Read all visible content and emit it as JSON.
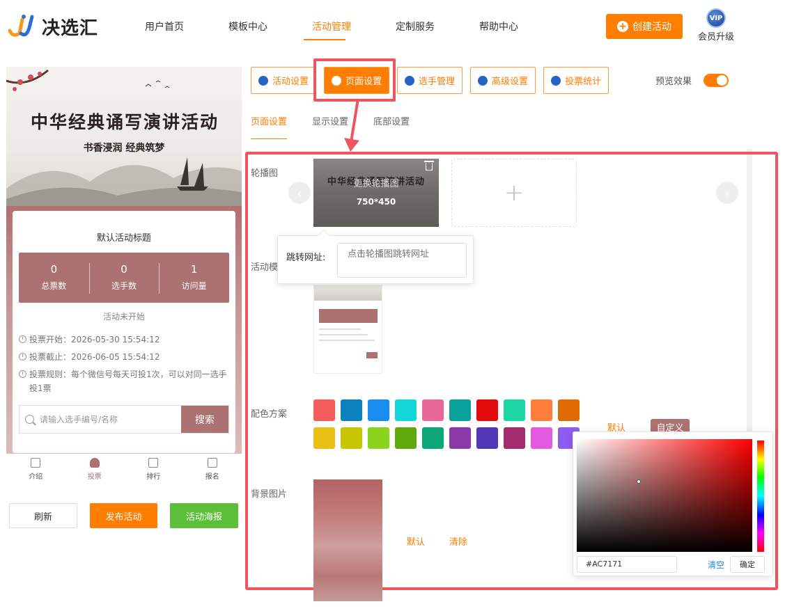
{
  "brand": {
    "name": "决选汇"
  },
  "nav": [
    "用户首页",
    "模板中心",
    "活动管理",
    "定制服务",
    "帮助中心"
  ],
  "header": {
    "create_label": "创建活动",
    "vip_badge": "VIP",
    "vip_label": "会员升级"
  },
  "toolbar": {
    "tabs": [
      "活动设置",
      "页面设置",
      "选手管理",
      "高级设置",
      "投票统计"
    ],
    "active": "页面设置",
    "preview_label": "预览效果",
    "preview_on": true
  },
  "subtabs": [
    "页面设置",
    "显示设置",
    "底部设置"
  ],
  "phone": {
    "banner_title": "中华经典诵写演讲活动",
    "banner_sub": "书香浸润   经典筑梦",
    "card_title": "默认活动标题",
    "stats": [
      {
        "num": "0",
        "label": "总票数"
      },
      {
        "num": "0",
        "label": "选手数"
      },
      {
        "num": "1",
        "label": "访问量"
      }
    ],
    "status": "活动未开始",
    "vote_start": "投票开始：2026-05-30 15:54:12",
    "vote_end": "投票截止：2026-06-05 15:54:12",
    "vote_rule": "投票规则：每个微信号每天可投1次，可以对同一选手投1票",
    "search_placeholder": "请输入选手编号/名称",
    "search_button": "搜索",
    "tabs": [
      "介绍",
      "投票",
      "排行",
      "报名"
    ],
    "active_tab": "投票"
  },
  "bottom": {
    "refresh": "刷新",
    "publish": "发布活动",
    "poster": "活动海报"
  },
  "settings": {
    "carousel_label": "轮播图",
    "carousel_overlay": "更换轮播图",
    "carousel_size": "750*450",
    "url_label": "跳转网址:",
    "url_placeholder": "点击轮播图跳转网址",
    "template_label": "活动模",
    "color_label": "配色方案",
    "color_default": "默认",
    "color_custom": "自定义",
    "swatches": [
      "#f45b5b",
      "#0a82bf",
      "#1a8cf0",
      "#12d6d8",
      "#e8689a",
      "#0aa19a",
      "#e10b0b",
      "#1dd6a8",
      "#ff7d3a",
      "#e26a05",
      "#e8c016",
      "#c8c502",
      "#8ad41b",
      "#5faa0a",
      "#0ca679",
      "#8b3aa8",
      "#5138b5",
      "#a52b6e",
      "#e15adf",
      "#8d5cf0"
    ],
    "picker_hex": "#AC7171",
    "picker_clear": "清空",
    "picker_ok": "确定",
    "bg_label": "背景图片",
    "bg_default": "默认",
    "bg_clear": "清除"
  },
  "colors": {
    "accent": "#ff7d00",
    "theme": "#ac7171",
    "highlight": "#f0545c"
  }
}
